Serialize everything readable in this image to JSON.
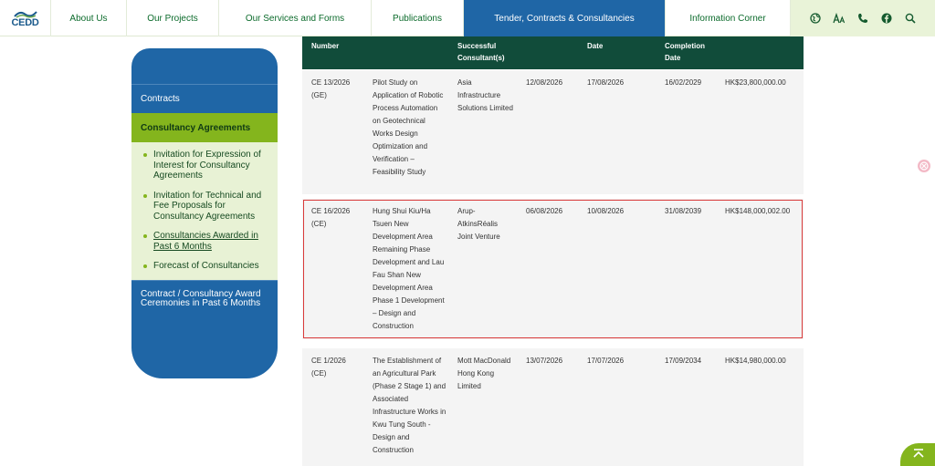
{
  "logo": {
    "text": "CEDD"
  },
  "nav": {
    "items": [
      {
        "label": "About Us"
      },
      {
        "label": "Our Projects"
      },
      {
        "label": "Our Services and Forms"
      },
      {
        "label": "Publications"
      },
      {
        "label": "Tender, Contracts & Consultancies"
      },
      {
        "label": "Information Corner"
      }
    ],
    "tools": [
      "globe-icon",
      "font-size-icon",
      "phone-icon",
      "facebook-icon",
      "search-icon"
    ]
  },
  "sidebar": {
    "contracts": "Contracts",
    "consultancy": "Consultancy Agreements",
    "sub_items": [
      {
        "label": "Invitation for Expression of Interest for Consultancy Agreements"
      },
      {
        "label": "Invitation for Technical and Fee Proposals for Consultancy Agreements"
      },
      {
        "label": "Consultancies Awarded in Past 6 Months"
      },
      {
        "label": "Forecast of Consultancies"
      }
    ],
    "award": "Contract / Consultancy Award Ceremonies in Past 6 Months"
  },
  "table": {
    "headers": {
      "number": "Number",
      "consultant": "Successful Consultant(s)",
      "date": "Date",
      "completion": "Completion Date"
    },
    "rows": [
      {
        "number": "CE 13/2026 (GE)",
        "title": "Pilot Study on Application of Robotic Process Automation on Geotechnical Works Design Optimization and Verification – Feasibility Study",
        "consultant": "Asia Infrastructure Solutions Limited",
        "date1": "12/08/2026",
        "date2": "17/08/2026",
        "completion": "16/02/2029",
        "amount": "HK$23,800,000.00"
      },
      {
        "number": "CE 16/2026 (CE)",
        "title": "Hung Shui Kiu/Ha Tsuen New Development Area Remaining Phase Development and Lau Fau Shan New Development Area Phase 1 Development – Design and Construction",
        "consultant": "Arup-AtkinsRéalis Joint Venture",
        "date1": "06/08/2026",
        "date2": "10/08/2026",
        "completion": "31/08/2039",
        "amount": "HK$148,000,002.00"
      },
      {
        "number": "CE 1/2026 (CE)",
        "title": "The Establishment of an Agricultural Park (Phase 2 Stage 1) and Associated Infrastructure Works in Kwu Tung South - Design and Construction",
        "consultant": "Mott MacDonald Hong Kong Limited",
        "date1": "13/07/2026",
        "date2": "17/07/2026",
        "completion": "17/09/2034",
        "amount": "HK$14,980,000.00"
      }
    ]
  },
  "colors": {
    "nav_active": "#1f66a6",
    "table_header": "#114c3a",
    "accent_green": "#84b51d",
    "highlight_border": "#d93a3a"
  }
}
